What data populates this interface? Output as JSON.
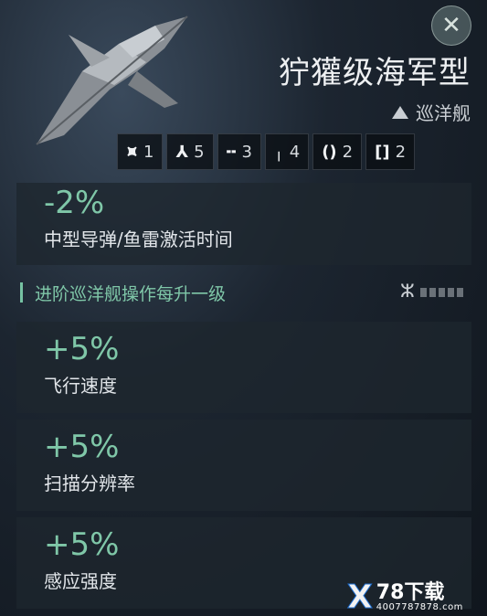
{
  "header": {
    "title": "狞獾级海军型",
    "ship_class": "巡洋舰",
    "close_icon": "close-icon"
  },
  "slots": [
    {
      "icon": "high-slot-icon",
      "glyph": "⯍",
      "value": "1"
    },
    {
      "icon": "turret-icon",
      "glyph": "⅄",
      "value": "5"
    },
    {
      "icon": "launcher-icon",
      "glyph": "╍",
      "value": "3"
    },
    {
      "icon": "mid-slot-icon",
      "glyph": "╷",
      "value": "4"
    },
    {
      "icon": "low-slot-icon",
      "glyph": "()",
      "value": "2"
    },
    {
      "icon": "rig-slot-icon",
      "glyph": "[]",
      "value": "2"
    }
  ],
  "bonus_top": {
    "value": "-2%",
    "label": "中型导弹/鱼雷激活时间"
  },
  "section": {
    "title": "进阶巡洋舰操作每升一级",
    "skill_icon": "dna-icon"
  },
  "bonuses": [
    {
      "value": "+5%",
      "label": "飞行速度"
    },
    {
      "value": "+5%",
      "label": "扫描分辨率"
    },
    {
      "value": "+5%",
      "label": "感应强度"
    }
  ],
  "watermark": {
    "main": "78下载",
    "sub": "4007787878.com",
    "mark": "X"
  },
  "colors": {
    "accent": "#7fc7a8",
    "panel": "#1e262e"
  }
}
